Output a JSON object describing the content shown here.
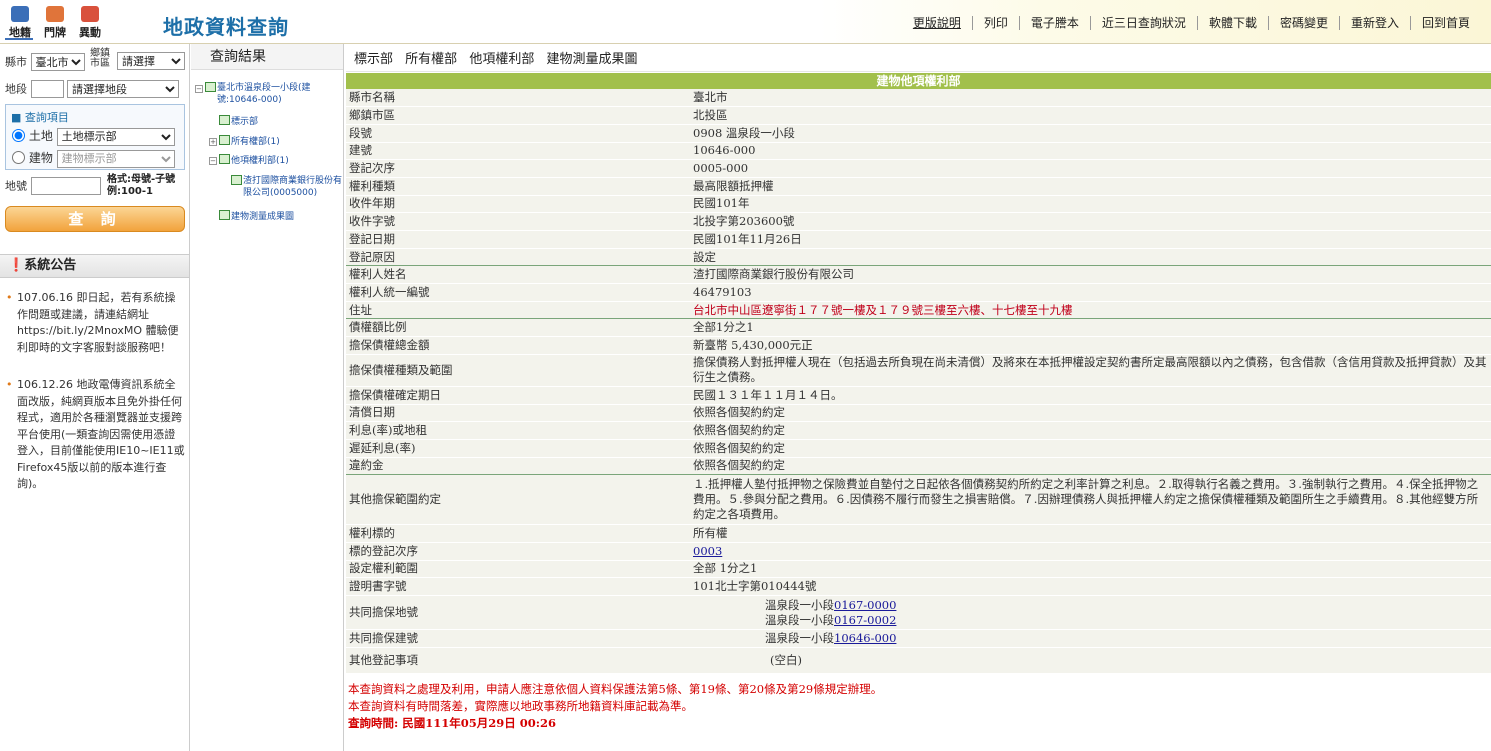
{
  "top_tabs": [
    {
      "label": "地籍",
      "color": "#3b6fb8"
    },
    {
      "label": "門牌",
      "color": "#e0743a"
    },
    {
      "label": "異動",
      "color": "#d9513c"
    }
  ],
  "site_title": "地政資料查詢",
  "top_links": [
    "更版說明",
    "列印",
    "電子謄本",
    "近三日查詢狀況",
    "軟體下載",
    "密碼變更",
    "重新登入",
    "回到首頁"
  ],
  "left": {
    "county_label": "縣市",
    "county_value": "臺北市",
    "town_label": "鄉鎮市區",
    "town_value": "請選擇",
    "section_label": "地段",
    "section_value": "請選擇地段",
    "query_item_title": "查詢項目",
    "land_label": "土地",
    "land_value": "土地標示部",
    "building_label": "建物",
    "building_value": "建物標示部",
    "lot_label": "地號",
    "lot_format": "格式:母號-子號 例:100-1",
    "query_button": "查 詢",
    "announcement_title": "系統公告",
    "announcements": [
      "107.06.16 即日起，若有系統操作問題或建議，請連結網址https://bit.ly/2MnoxMO 體驗便利即時的文字客服對談服務吧！",
      "106.12.26 地政電傳資訊系統全面改版，純網頁版本且免外掛任何程式，適用於各種瀏覽器並支援跨平台使用(一類查詢因需使用憑證登入，目前僅能使用IE10~IE11或Firefox45版以前的版本進行查詢)。"
    ]
  },
  "middle": {
    "title": "查詢結果",
    "tree": {
      "root": "臺北市溫泉段一小段(建號:10646-000)",
      "n1": "標示部",
      "n2": "所有權部(1)",
      "n3": "他項權利部(1)",
      "n3a": "渣打國際商業銀行股份有限公司(0005000)",
      "n4": "建物測量成果圖"
    }
  },
  "main": {
    "tabs": [
      "標示部",
      "所有權部",
      "他項權利部",
      "建物測量成果圖"
    ],
    "section_title": "建物他項權利部",
    "rows": [
      [
        "縣市名稱",
        "臺北市"
      ],
      [
        "鄉鎮市區",
        "北投區"
      ],
      [
        "段號",
        "0908 溫泉段一小段"
      ],
      [
        "建號",
        "10646-000"
      ],
      [
        "登記次序",
        "0005-000"
      ],
      [
        "權利種類",
        "最高限額抵押權"
      ],
      [
        "收件年期",
        "民國101年"
      ],
      [
        "收件字號",
        "北投字第203600號"
      ],
      [
        "登記日期",
        "民國101年11月26日"
      ],
      [
        "登記原因",
        "設定"
      ],
      [
        "權利人姓名",
        "渣打國際商業銀行股份有限公司"
      ],
      [
        "權利人統一編號",
        "46479103"
      ],
      [
        "住址",
        "台北市中山區遼寧街１７７號一樓及１７９號三樓至六樓、十七樓至十九樓"
      ],
      [
        "債權額比例",
        "全部1分之1"
      ],
      [
        "擔保債權總金額",
        "新臺幣 5,430,000元正"
      ],
      [
        "擔保債權種類及範圍",
        "擔保債務人對抵押權人現在（包括過去所負現在尚未清償）及將來在本抵押權設定契約書所定最高限額以內之債務，包含借款（含信用貸款及抵押貸款）及其衍生之債務。"
      ],
      [
        "擔保債權確定期日",
        "民國１３１年１１月１４日。"
      ],
      [
        "清償日期",
        "依照各個契約約定"
      ],
      [
        "利息(率)或地租",
        "依照各個契約約定"
      ],
      [
        "遲延利息(率)",
        "依照各個契約約定"
      ],
      [
        "違約金",
        "依照各個契約約定"
      ],
      [
        "其他擔保範圍約定",
        "１.抵押權人墊付抵押物之保險費並自墊付之日起依各個債務契約所約定之利率計算之利息。２.取得執行名義之費用。３.強制執行之費用。４.保全抵押物之費用。５.參與分配之費用。６.因債務不履行而發生之損害賠償。７.因辦理債務人與抵押權人約定之擔保債權種類及範圍所生之手續費用。８.其他經雙方所約定之各項費用。"
      ],
      [
        "權利標的",
        "所有權"
      ],
      [
        "標的登記次序",
        "0003"
      ],
      [
        "設定權利範圍",
        "全部 1分之1"
      ],
      [
        "證明書字號",
        "101北士字第010444號"
      ]
    ],
    "joint_land_label": "共同擔保地號",
    "joint_land": [
      {
        "prefix": "溫泉段一小段",
        "num": "0167-0000"
      },
      {
        "prefix": "溫泉段一小段",
        "num": "0167-0002"
      }
    ],
    "joint_building_label": "共同擔保建號",
    "joint_building": {
      "prefix": "溫泉段一小段",
      "num": "10646-000"
    },
    "other_label": "其他登記事項",
    "other_value": "(空白)",
    "footnotes": [
      "本查詢資料之處理及利用，申請人應注意依個人資料保護法第5條、第19條、第20條及第29條規定辦理。",
      "本查詢資料有時間落差，實際應以地政事務所地籍資料庫記載為準。",
      "查詢時間: 民國111年05月29日 00:26"
    ]
  }
}
